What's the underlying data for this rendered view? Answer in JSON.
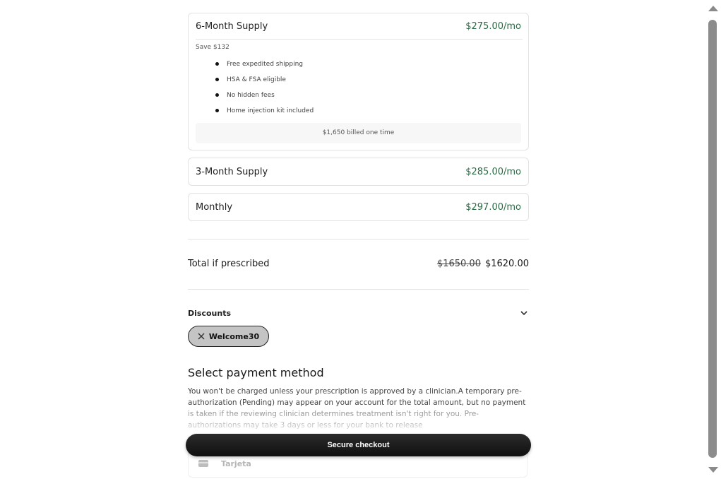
{
  "plans": [
    {
      "name": "6-Month Supply",
      "price": "$275.00/mo",
      "save": "Save $132",
      "features": [
        "Free expedited shipping",
        "HSA & FSA eligible",
        "No hidden fees",
        "Home injection kit included"
      ],
      "billed": "$1,650 billed one time"
    },
    {
      "name": "3-Month Supply",
      "price": "$285.00/mo"
    },
    {
      "name": "Monthly",
      "price": "$297.00/mo"
    }
  ],
  "total": {
    "label": "Total if prescribed",
    "old_price": "$1650.00",
    "new_price": "$1620.00"
  },
  "discounts": {
    "label": "Discounts",
    "chip": "Welcome30"
  },
  "payment": {
    "title": "Select payment method",
    "description": "You won't be charged unless your prescription is approved by a clinician.A temporary pre-authorization (Pending) may appear on your account for the total amount, but no payment is taken if the reviewing clinician determines treatment isn't right for you. Pre-authorizations may take 3 days or less for your bank to release",
    "option_label": "Tarjeta"
  },
  "checkout_label": "Secure checkout",
  "colors": {
    "price_green": "#2a6b45",
    "button_dark": "#1a1a1a"
  }
}
